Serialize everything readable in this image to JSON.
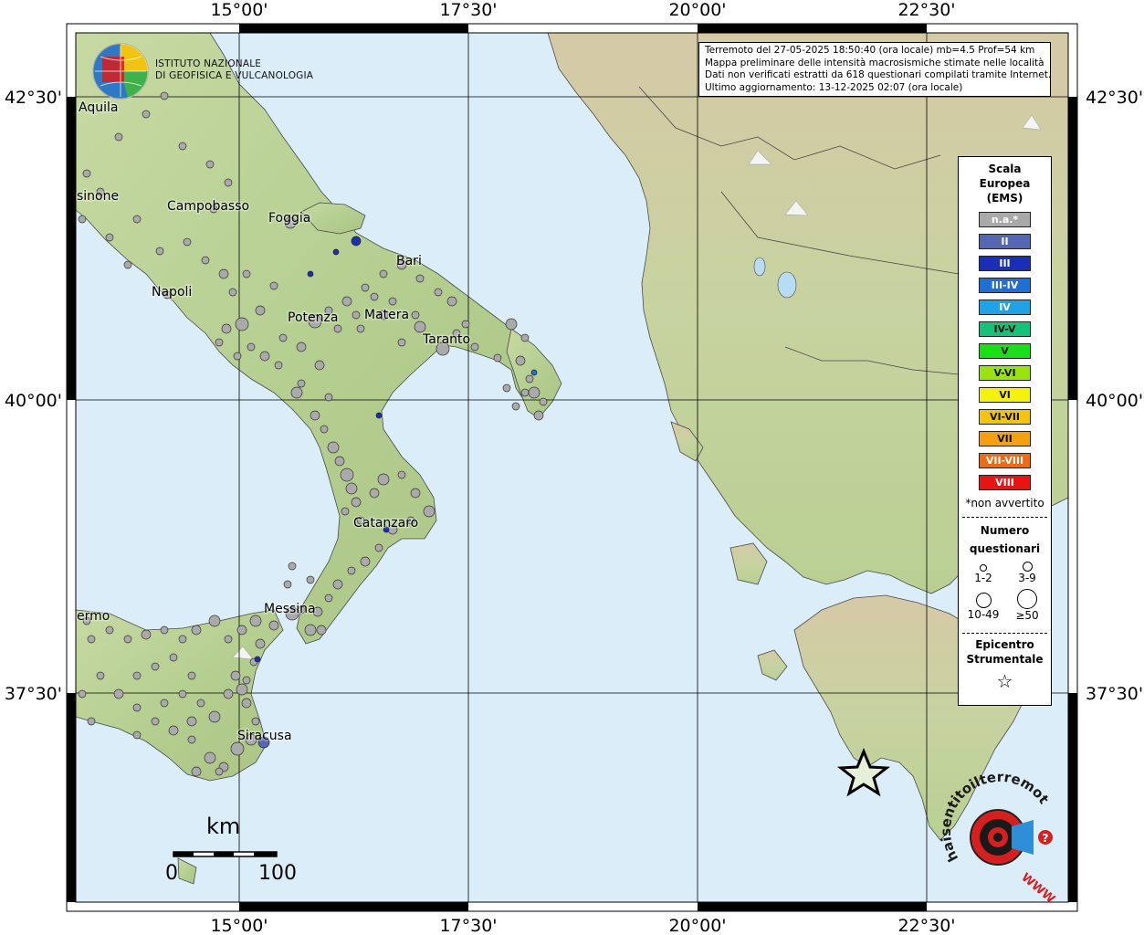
{
  "info_box": {
    "line1": "Terremoto del 27-05-2025 18:50:40 (ora locale) mb=4.5 Prof=54 km",
    "line2": "Mappa preliminare delle intensità macrosismiche stimate nelle località",
    "line3": "Dati non verificati estratti da 618 questionari compilati tramite Internet.",
    "line4": "Ultimo aggiornamento: 13-12-2025 02:07 (ora locale)"
  },
  "logo": {
    "line1": "ISTITUTO NAZIONALE",
    "line2": "DI GEOFISICA E VULCANOLOGIA"
  },
  "axes": {
    "lon_ticks": [
      "15°00'",
      "17°30'",
      "20°00'",
      "22°30'"
    ],
    "lat_ticks": [
      "42°30'",
      "40°00'",
      "37°30'"
    ]
  },
  "cities": [
    {
      "name": "Aquila"
    },
    {
      "name": "sinone"
    },
    {
      "name": "Campobasso"
    },
    {
      "name": "Foggia"
    },
    {
      "name": "Bari"
    },
    {
      "name": "Napoli"
    },
    {
      "name": "Potenza"
    },
    {
      "name": "Matera"
    },
    {
      "name": "Taranto"
    },
    {
      "name": "Catanzaro"
    },
    {
      "name": "Messina"
    },
    {
      "name": "ermo"
    },
    {
      "name": "Siracusa"
    }
  ],
  "legend": {
    "title": "Scala Europea (EMS)",
    "title_lines": [
      "Scala",
      "Europea",
      "(EMS)"
    ],
    "classes": [
      {
        "label": "n.a.*",
        "color": "#a9a9a9"
      },
      {
        "label": "II",
        "color": "#5567b3"
      },
      {
        "label": "III",
        "color": "#1a2fb5"
      },
      {
        "label": "III-IV",
        "color": "#1f6fd6"
      },
      {
        "label": "IV",
        "color": "#1fa3e6"
      },
      {
        "label": "IV-V",
        "color": "#14c27a"
      },
      {
        "label": "V",
        "color": "#17e017"
      },
      {
        "label": "V-VI",
        "color": "#9be30f"
      },
      {
        "label": "VI",
        "color": "#f2f20e"
      },
      {
        "label": "VI-VII",
        "color": "#f2c40e"
      },
      {
        "label": "VII",
        "color": "#f5a00d"
      },
      {
        "label": "VII-VIII",
        "color": "#ef6a12"
      },
      {
        "label": "VIII",
        "color": "#e81414"
      }
    ],
    "note": "*non avvertito",
    "questionnaires_title": [
      "Numero",
      "questionari"
    ],
    "questionnaires": [
      {
        "label": "1-2"
      },
      {
        "label": "3-9"
      },
      {
        "label": "10-49"
      },
      {
        "label": "≥50"
      }
    ],
    "epicenter_title": [
      "Epicentro",
      "Strumentale"
    ]
  },
  "scale_bar": {
    "unit": "km",
    "start": "0",
    "end": "100"
  },
  "watermark": {
    "text": "haisentitoilterremoto.it",
    "url_text": "WWW"
  },
  "colors": {
    "sea": "#dcedfa",
    "land": "#b9d39a",
    "graticule": "#000000",
    "frame": "#000000",
    "epicenter": "#e6f0d8"
  }
}
